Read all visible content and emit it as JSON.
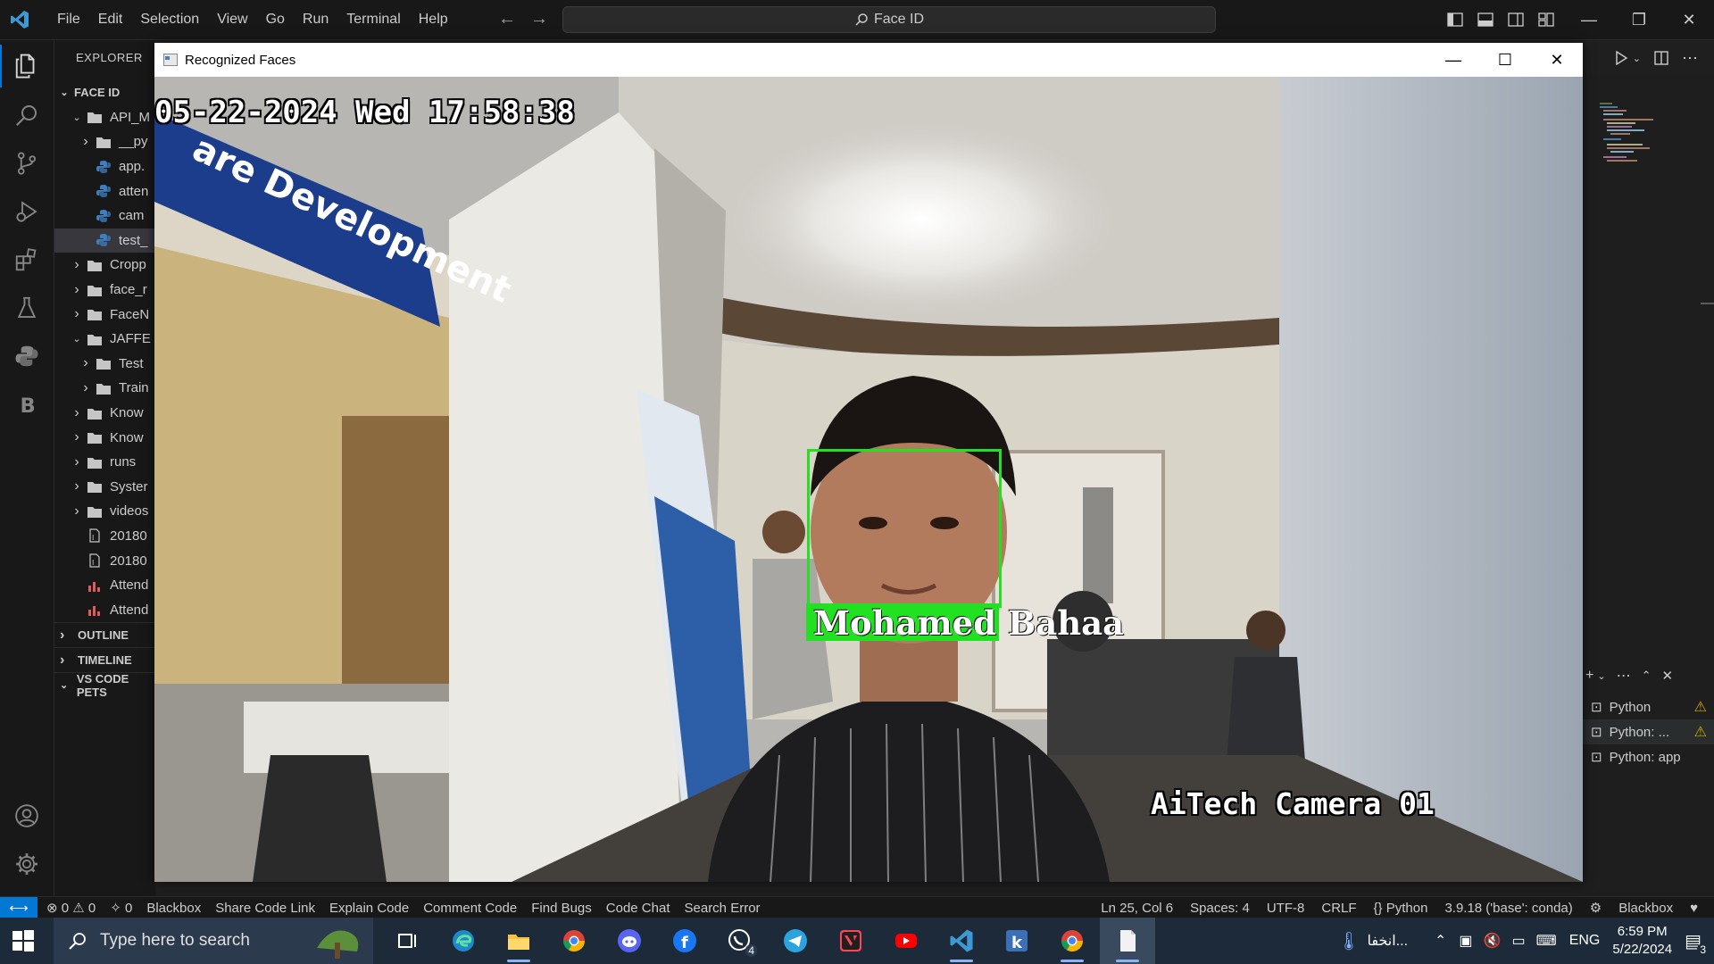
{
  "window": {
    "search_text": "Face ID"
  },
  "menu": [
    "File",
    "Edit",
    "Selection",
    "View",
    "Go",
    "Run",
    "Terminal",
    "Help"
  ],
  "explorer": {
    "title": "EXPLORER",
    "root": "FACE ID",
    "rows": [
      {
        "label": "API_M",
        "kind": "folder",
        "open": true,
        "depth": 1
      },
      {
        "label": "__py",
        "kind": "folder",
        "open": false,
        "depth": 2
      },
      {
        "label": "app.",
        "kind": "py",
        "depth": 2
      },
      {
        "label": "atten",
        "kind": "py",
        "depth": 2
      },
      {
        "label": "cam",
        "kind": "py",
        "depth": 2
      },
      {
        "label": "test_",
        "kind": "py",
        "depth": 2,
        "selected": true
      },
      {
        "label": "Cropp",
        "kind": "folder",
        "open": false,
        "depth": 1
      },
      {
        "label": "face_r",
        "kind": "folder",
        "open": false,
        "depth": 1
      },
      {
        "label": "FaceN",
        "kind": "folder",
        "open": false,
        "depth": 1
      },
      {
        "label": "JAFFE",
        "kind": "folder",
        "open": true,
        "depth": 1
      },
      {
        "label": "Test",
        "kind": "folder",
        "open": false,
        "depth": 2
      },
      {
        "label": "Train",
        "kind": "folder",
        "open": false,
        "depth": 2
      },
      {
        "label": "Know",
        "kind": "folder",
        "open": false,
        "depth": 1
      },
      {
        "label": "Know",
        "kind": "folder",
        "open": false,
        "depth": 1
      },
      {
        "label": "runs",
        "kind": "folder",
        "open": false,
        "depth": 1
      },
      {
        "label": "Syster",
        "kind": "folder",
        "open": false,
        "depth": 1
      },
      {
        "label": "videos",
        "kind": "folder",
        "open": false,
        "depth": 1
      },
      {
        "label": "20180",
        "kind": "file",
        "depth": 1
      },
      {
        "label": "20180",
        "kind": "file",
        "depth": 1
      },
      {
        "label": "Attend",
        "kind": "csv",
        "depth": 1
      },
      {
        "label": "Attend",
        "kind": "csv",
        "depth": 1
      }
    ],
    "sections": [
      "OUTLINE",
      "TIMELINE",
      "VS CODE PETS"
    ]
  },
  "face_window": {
    "title": "Recognized Faces",
    "timestamp": "05-22-2024 Wed 17:58:38",
    "camera_name": "AiTech Camera 01",
    "person_first": "Mohamed",
    "person_last": "Bahaa",
    "box_color": "#22e022"
  },
  "terminals": [
    {
      "label": "Python",
      "warn": true
    },
    {
      "label": "Python: ...",
      "warn": true,
      "selected": true
    },
    {
      "label": "Python: app",
      "warn": false
    }
  ],
  "statusbar": {
    "errors": "0",
    "warnings": "0",
    "ports": "0",
    "left_items": [
      "Blackbox",
      "Share Code Link",
      "Explain Code",
      "Comment Code",
      "Find Bugs",
      "Code Chat",
      "Search Error"
    ],
    "cursor": "Ln 25, Col 6",
    "spaces": "Spaces: 4",
    "encoding": "UTF-8",
    "eol": "CRLF",
    "language": "Python",
    "interpreter": "3.9.18 ('base': conda)",
    "blackbox": "Blackbox"
  },
  "taskbar": {
    "search_placeholder": "Type here to search",
    "weather_text": "انخفا...",
    "lang": "ENG",
    "time": "6:59 PM",
    "date": "5/22/2024",
    "notifications": "3",
    "whatsapp_badge": "4"
  }
}
